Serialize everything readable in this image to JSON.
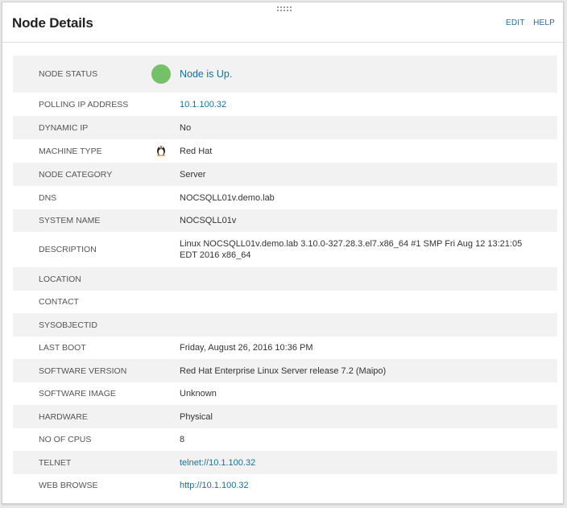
{
  "panel": {
    "title": "Node Details",
    "edit_label": "EDIT",
    "help_label": "HELP"
  },
  "colors": {
    "status_up": "#77c06a",
    "link": "#1e6d97",
    "row_alt": "#f2f2f2"
  },
  "rows": [
    {
      "label": "NODE STATUS",
      "value": "Node is Up.",
      "icon": "status-up-dot"
    },
    {
      "label": "POLLING IP ADDRESS",
      "value": "10.1.100.32"
    },
    {
      "label": "DYNAMIC IP",
      "value": "No"
    },
    {
      "label": "MACHINE TYPE",
      "value": "Red Hat",
      "icon": "linux-tux-icon"
    },
    {
      "label": "NODE CATEGORY",
      "value": "Server"
    },
    {
      "label": "DNS",
      "value": "NOCSQLL01v.demo.lab"
    },
    {
      "label": "SYSTEM NAME",
      "value": "NOCSQLL01v"
    },
    {
      "label": "DESCRIPTION",
      "value": "Linux NOCSQLL01v.demo.lab 3.10.0-327.28.3.el7.x86_64 #1 SMP Fri Aug 12 13:21:05 EDT 2016 x86_64"
    },
    {
      "label": "LOCATION",
      "value": ""
    },
    {
      "label": "CONTACT",
      "value": ""
    },
    {
      "label": "SYSOBJECTID",
      "value": ""
    },
    {
      "label": "LAST BOOT",
      "value": "Friday, August 26, 2016 10:36 PM"
    },
    {
      "label": "SOFTWARE VERSION",
      "value": "Red Hat Enterprise Linux Server release 7.2 (Maipo)"
    },
    {
      "label": "SOFTWARE IMAGE",
      "value": "Unknown"
    },
    {
      "label": "HARDWARE",
      "value": "Physical"
    },
    {
      "label": "NO OF CPUS",
      "value": "8"
    },
    {
      "label": "TELNET",
      "value": "telnet://10.1.100.32"
    },
    {
      "label": "WEB BROWSE",
      "value": "http://10.1.100.32"
    }
  ]
}
